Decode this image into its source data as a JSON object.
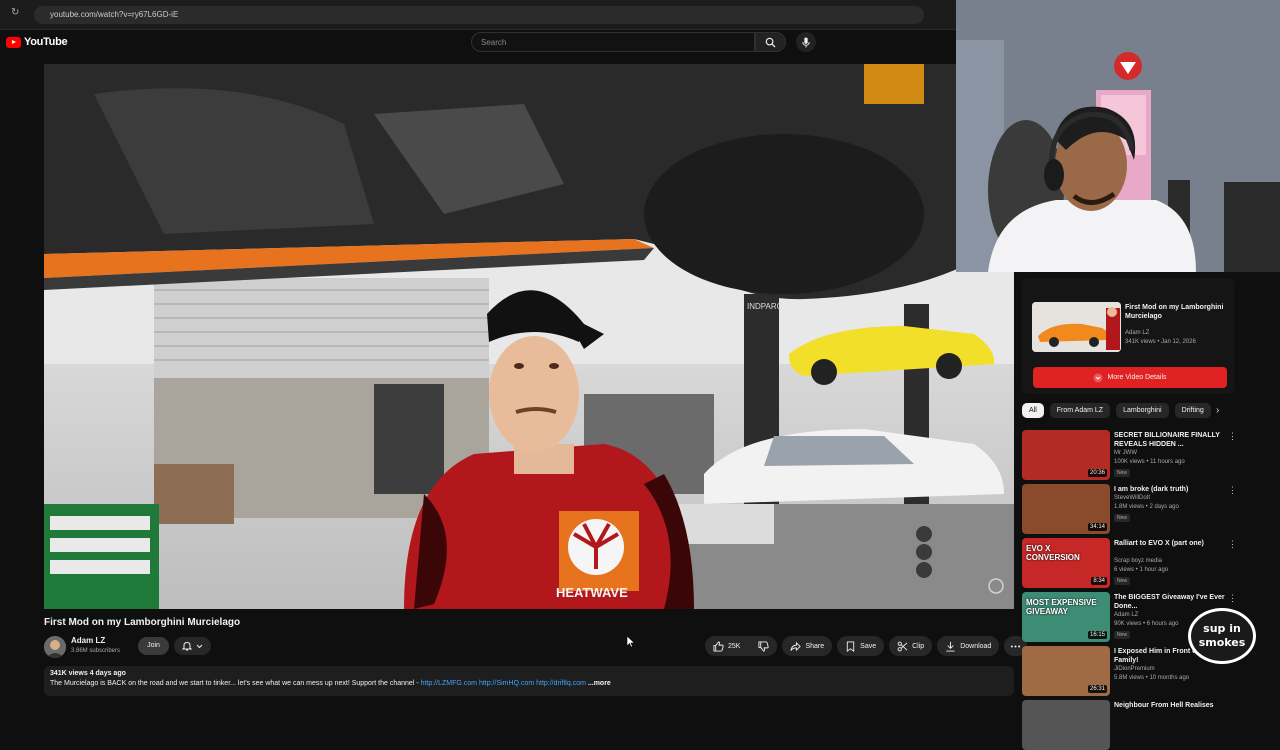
{
  "browser": {
    "url": "youtube.com/watch?v=ry67L6GD-iE"
  },
  "header": {
    "logo_text": "YouTube",
    "search_placeholder": "Search"
  },
  "video": {
    "title": "First Mod on my Lamborghini Murcielago",
    "channel": "Adam LZ",
    "subscribers": "3.86M subscribers",
    "join_label": "Join",
    "like_count": "25K",
    "share_label": "Share",
    "save_label": "Save",
    "clip_label": "Clip",
    "download_label": "Download",
    "shirt_text": "HEATWAVE",
    "garage_sign": "INDPARC"
  },
  "description": {
    "meta": "341K views  4 days ago",
    "text": "The Murcielago is BACK on the road and we start to tinker... let's see what we can mess up next! Support the channel - ",
    "links": "http://LZMFG.com http://SimHQ.com http://driftlq.com",
    "more": "...more"
  },
  "info_card": {
    "title": "First Mod on my Lamborghini Murcielago",
    "channel": "Adam LZ",
    "meta": "341K views • Jan 12, 2026",
    "button": "More Video Details"
  },
  "chips": [
    "All",
    "From Adam LZ",
    "Lamborghini",
    "Drifting"
  ],
  "recommendations": [
    {
      "title": "SECRET BILLIONAIRE FINALLY REVEALS HIDDEN ...",
      "channel": "Mr JWW",
      "meta": "100K views • 11 hours ago",
      "badge": "New",
      "duration": "20:36",
      "thumb": "#b42a24"
    },
    {
      "title": "I am broke (dark truth)",
      "channel": "SteveWillDoIt",
      "meta": "1.8M views • 2 days ago",
      "badge": "New",
      "duration": "34:14",
      "thumb": "#8a4a2c"
    },
    {
      "title": "Ralliart to EVO X (part one)",
      "channel": "Scrap boyz media",
      "meta": "6 views • 1 hour ago",
      "badge": "New",
      "duration": "8:34",
      "thumb": "#c62828",
      "overlay": "EVO X CONVERSION"
    },
    {
      "title": "The BIGGEST Giveaway I've Ever Done...",
      "channel": "Adam LZ",
      "meta": "90K views • 6 hours ago",
      "badge": "New",
      "duration": "16:15",
      "thumb": "#3d8c74",
      "overlay": "MOST EXPENSIVE GIVEAWAY"
    },
    {
      "title": "I Exposed Him in Front of My Family!",
      "channel": "JiDionPremium",
      "meta": "5.8M views • 10 months ago",
      "badge": "",
      "duration": "26:31",
      "thumb": "#a06a44"
    },
    {
      "title": "Neighbour From Hell Realises",
      "channel": "",
      "meta": "",
      "badge": "",
      "duration": "",
      "thumb": "#555"
    }
  ],
  "overlay_logo": "sup in smokes"
}
